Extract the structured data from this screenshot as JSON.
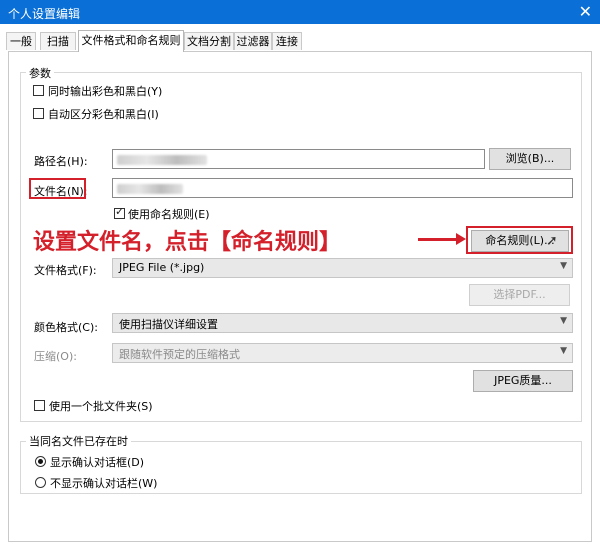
{
  "window": {
    "title": "个人设置编辑",
    "close_glyph": "✕"
  },
  "tabs": [
    {
      "label": "一般"
    },
    {
      "label": "扫描"
    },
    {
      "label": "文件格式和命名规则"
    },
    {
      "label": "文档分割"
    },
    {
      "label": "过滤器"
    },
    {
      "label": "连接"
    }
  ],
  "params": {
    "group_label": "参数",
    "checkbox_color_bw": "同时输出彩色和黑白(Y)",
    "checkbox_auto_separate": "自动区分彩色和黑白(I)",
    "path_label": "路径名(H):",
    "browse_button": "浏览(B)...",
    "filename_label": "文件名(N):",
    "use_naming_rule": "使用命名规则(E)",
    "naming_rule_button": "命名规则(L)...",
    "file_format_label": "文件格式(F):",
    "file_format_value": "JPEG File (*.jpg)",
    "select_pdf_button": "选择PDF...",
    "color_format_label": "颜色格式(C):",
    "color_format_value": "使用扫描仪详细设置",
    "compression_label": "压缩(O):",
    "compression_value": "跟随软件预定的压缩格式",
    "jpeg_quality_button": "JPEG质量...",
    "use_batch_folder": "使用一个批文件夹(S)"
  },
  "exists": {
    "group_label": "当同名文件已存在时",
    "radio_show_dialog": "显示确认对话框(D)",
    "radio_no_dialog": "不显示确认对话栏(W)"
  },
  "annotation": {
    "text": "设置文件名，点击【命名规则】"
  },
  "colors": {
    "accent_red": "#d4202a",
    "titlebar": "#0a6fd6"
  }
}
